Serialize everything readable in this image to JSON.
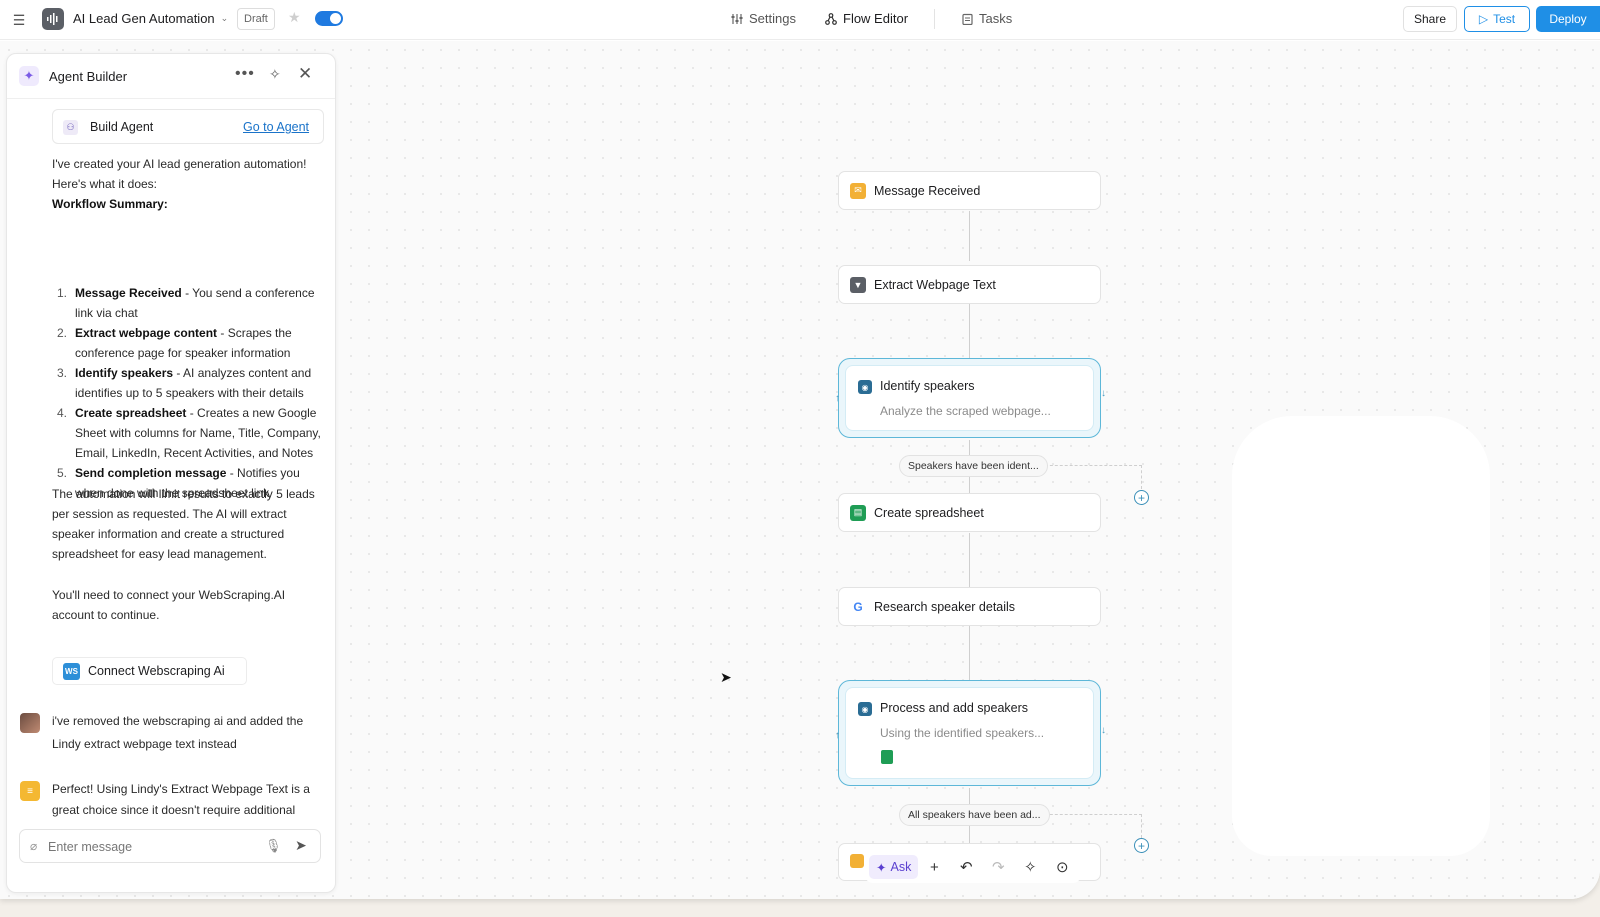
{
  "header": {
    "app_title": "AI Lead Gen Automation",
    "draft_label": "Draft",
    "nav": {
      "settings": "Settings",
      "flow_editor": "Flow Editor",
      "tasks": "Tasks"
    },
    "share_label": "Share",
    "test_label": "Test",
    "deploy_label": "Deploy",
    "toggle_on": true
  },
  "panel": {
    "title": "Agent Builder",
    "build_card": {
      "label": "Build Agent",
      "link": "Go to Agent"
    },
    "intro_line1": "I've created your AI lead generation automation!",
    "intro_line2": "Here's what it does:",
    "summary_heading": "Workflow Summary:",
    "steps": [
      {
        "num": "1.",
        "bold": "Message Received",
        "text": " - You send a conference link via chat"
      },
      {
        "num": "2.",
        "bold": "Extract webpage content",
        "text": " - Scrapes the conference page for speaker information"
      },
      {
        "num": "3.",
        "bold": "Identify speakers",
        "text": " - AI analyzes content and identifies up to 5 speakers with their details"
      },
      {
        "num": "4.",
        "bold": "Create spreadsheet",
        "text": " - Creates a new Google Sheet with columns for Name, Title, Company, Email, LinkedIn, Recent Activities, and Notes"
      },
      {
        "num": "5.",
        "bold": "Send completion message",
        "text": " - Notifies you when done with the spreadsheet link"
      }
    ],
    "closing_paragraph": "The automation will limit results to exactly 5 leads per session as requested. The AI will extract speaker information and create a structured spreadsheet for easy lead management.",
    "connect_note": "You'll need to connect your WebScraping.AI account to continue.",
    "connect_button": {
      "logo": "WS",
      "label": "Connect Webscraping Ai"
    },
    "user_message": "i've removed the webscraping ai and added the Lindy extract webpage text instead",
    "bot_message": "Perfect! Using Lindy's Extract Webpage Text is a great choice since it doesn't require additional",
    "input_placeholder": "Enter message"
  },
  "flow": {
    "nodes": [
      {
        "label": "Message Received",
        "icon": "chat-trigger-icon",
        "color": "#f2b035"
      },
      {
        "label": "Extract Webpage Text",
        "icon": "webpage-icon",
        "color": "#5b5f66"
      },
      {
        "label": "Identify speakers",
        "subtitle": "Analyze the scraped webpage...",
        "icon": "ai-agent-icon",
        "color": "#2a6c94"
      },
      {
        "label": "Create spreadsheet",
        "icon": "google-sheets-icon",
        "color": "#1f9d55"
      },
      {
        "label": "Research speaker details",
        "icon": "google-icon",
        "color": "#4285f4"
      },
      {
        "label": "Process and add speakers",
        "subtitle": "Using the identified speakers...",
        "icon": "ai-agent-icon",
        "color": "#2a6c94"
      }
    ],
    "conditions": [
      "Speakers have been ident...",
      "All speakers have been ad..."
    ]
  },
  "toolbar": {
    "ask_label": "Ask"
  },
  "colors": {
    "accent": "#1f8fe6",
    "ai_border": "#5db7d8",
    "ai_fill": "#eaf6fb"
  }
}
